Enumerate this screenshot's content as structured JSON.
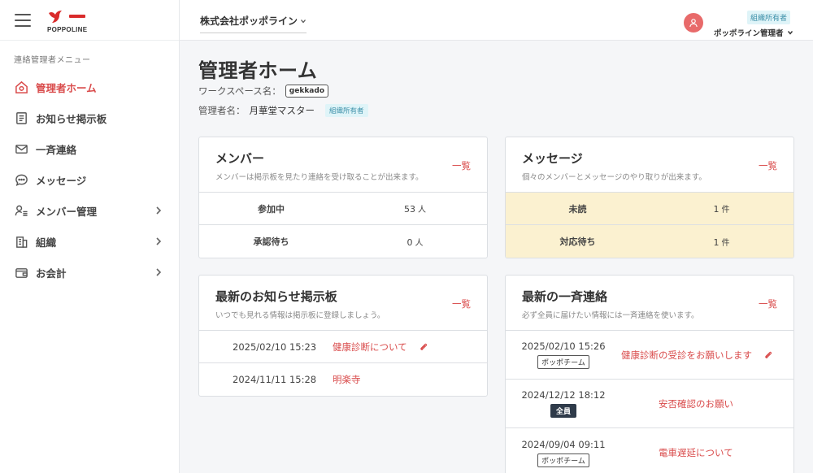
{
  "sidebar": {
    "logo_text": "POPPOLINE",
    "menu_heading": "連絡管理者メニュー",
    "items": [
      {
        "label": "管理者ホーム"
      },
      {
        "label": "お知らせ掲示板"
      },
      {
        "label": "一斉連絡"
      },
      {
        "label": "メッセージ"
      },
      {
        "label": "メンバー管理"
      },
      {
        "label": "組織"
      },
      {
        "label": "お会計"
      }
    ]
  },
  "header": {
    "company": "株式会社ポッポライン",
    "role_badge": "組織所有者",
    "user_name": "ポッポライン管理者"
  },
  "main": {
    "title": "管理者ホーム",
    "workspace_label": "ワークスペース名：",
    "workspace_name": "gekkado",
    "admin_label": "管理者名：",
    "admin_name": "月華堂マスター",
    "admin_badge": "組織所有者"
  },
  "members_card": {
    "title": "メンバー",
    "subtitle": "メンバーは掲示板を見たり連絡を受け取ることが出来ます。",
    "link": "一覧",
    "rows": [
      {
        "label": "参加中",
        "value": "53",
        "unit": "人"
      },
      {
        "label": "承認待ち",
        "value": "0",
        "unit": "人"
      }
    ]
  },
  "messages_card": {
    "title": "メッセージ",
    "subtitle": "個々のメンバーとメッセージのやり取りが出来ます。",
    "link": "一覧",
    "rows": [
      {
        "label": "未読",
        "value": "1",
        "unit": "件"
      },
      {
        "label": "対応待ち",
        "value": "1",
        "unit": "件"
      }
    ]
  },
  "notices_card": {
    "title": "最新のお知らせ掲示板",
    "subtitle": "いつでも見れる情報は掲示板に登録しましょう。",
    "link": "一覧",
    "rows": [
      {
        "date": "2025/02/10 15:23",
        "title": "健康診断について",
        "attachment": true
      },
      {
        "date": "2024/11/11 15:28",
        "title": "明楽寺",
        "attachment": false
      }
    ]
  },
  "broadcast_card": {
    "title": "最新の一斉連絡",
    "subtitle": "必ず全員に届けたい情報には一斉連絡を使います。",
    "link": "一覧",
    "rows": [
      {
        "date": "2025/02/10 15:26",
        "tag": "ポッポチーム",
        "title": "健康診断の受診をお願いします",
        "attachment": true
      },
      {
        "date": "2024/12/12 18:12",
        "tag": "全員",
        "title": "安否確認のお願い",
        "attachment": false
      },
      {
        "date": "2024/09/04 09:11",
        "tag": "ポッポチーム",
        "title": "電車遅延について",
        "attachment": false
      }
    ]
  }
}
